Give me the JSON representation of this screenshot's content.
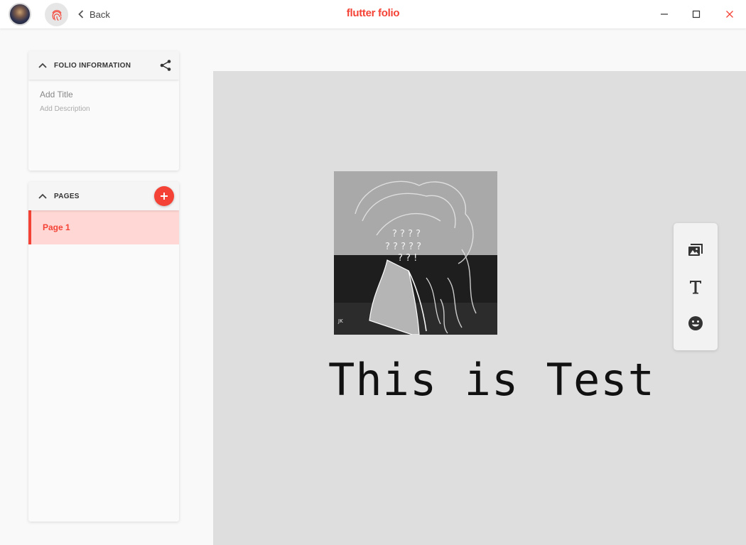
{
  "app": {
    "title": "flutter folio",
    "brand_color": "#f44336"
  },
  "titlebar": {
    "avatar_icon": "user-avatar",
    "fingerprint_icon": "fingerprint-icon",
    "back_label": "Back",
    "controls": [
      "minimize-icon",
      "maximize-icon",
      "close-icon"
    ]
  },
  "folio_info": {
    "header": "FOLIO INFORMATION",
    "title_placeholder": "Add Title",
    "description_placeholder": "Add Description"
  },
  "pages": {
    "header": "PAGES",
    "items": [
      {
        "label": "Page 1",
        "selected": true
      }
    ]
  },
  "canvas": {
    "text_box": "This is Test",
    "image_icon": "artwork-image"
  },
  "tools": [
    "add-image-icon",
    "add-text-icon",
    "add-emoji-icon"
  ]
}
